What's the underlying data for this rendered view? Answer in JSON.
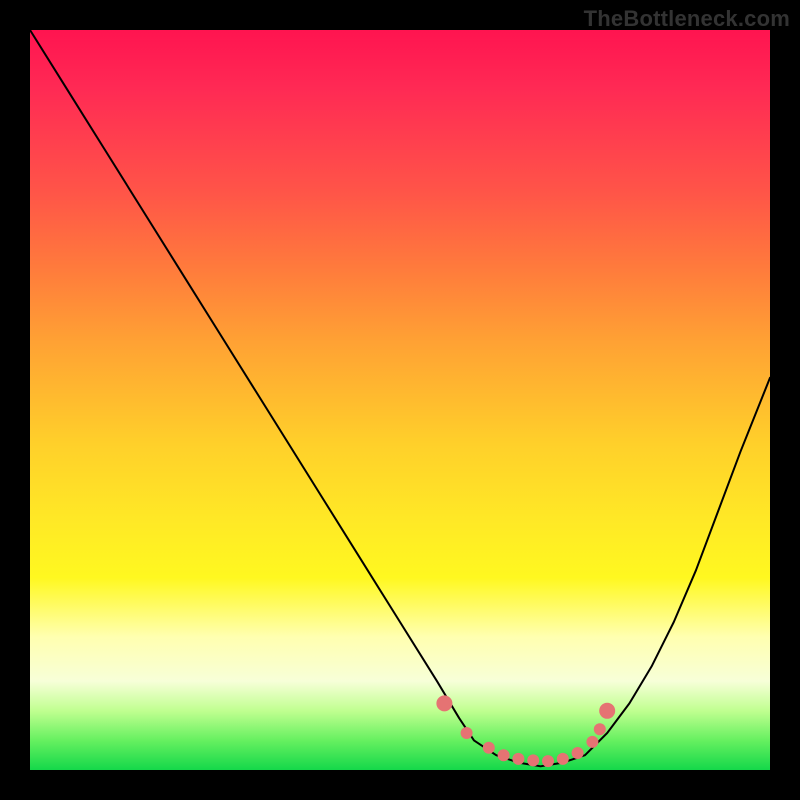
{
  "watermark": "TheBottleneck.com",
  "chart_data": {
    "type": "line",
    "title": "",
    "xlabel": "",
    "ylabel": "",
    "xlim": [
      0,
      100
    ],
    "ylim": [
      0,
      100
    ],
    "grid": false,
    "annotations": [],
    "series": [
      {
        "name": "curve",
        "color": "#000000",
        "x": [
          0,
          5,
          10,
          15,
          20,
          25,
          30,
          35,
          40,
          45,
          50,
          55,
          58,
          60,
          63,
          66,
          69,
          72,
          75,
          78,
          81,
          84,
          87,
          90,
          93,
          96,
          100
        ],
        "values": [
          100,
          92,
          84,
          76,
          68,
          60,
          52,
          44,
          36,
          28,
          20,
          12,
          7,
          4,
          2,
          1,
          0.5,
          1,
          2,
          5,
          9,
          14,
          20,
          27,
          35,
          43,
          53
        ]
      },
      {
        "name": "highlight-dots",
        "color": "#e57373",
        "x": [
          56,
          59,
          62,
          64,
          66,
          68,
          70,
          72,
          74,
          76,
          77,
          78
        ],
        "values": [
          9,
          5,
          3,
          2,
          1.5,
          1.3,
          1.2,
          1.5,
          2.3,
          3.8,
          5.5,
          8
        ]
      }
    ]
  },
  "colors": {
    "background": "#000000",
    "gradient_top": "#ff1450",
    "gradient_mid_orange": "#ffa134",
    "gradient_mid_yellow": "#ffe826",
    "gradient_bottom": "#14d84a",
    "curve": "#000000",
    "highlight": "#e57373"
  }
}
